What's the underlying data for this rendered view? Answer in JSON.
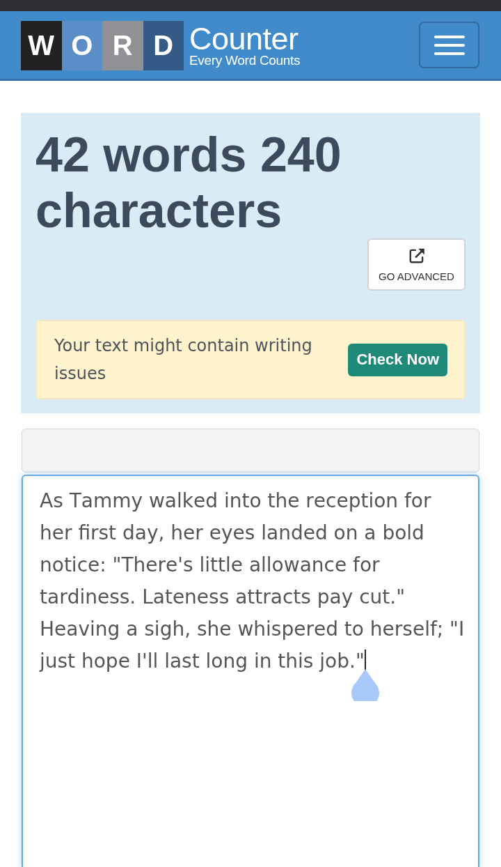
{
  "header": {
    "logo": {
      "tiles": [
        {
          "letter": "W",
          "color": "#222222"
        },
        {
          "letter": "O",
          "color": "#5b8ec7"
        },
        {
          "letter": "R",
          "color": "#8f9194"
        },
        {
          "letter": "D",
          "color": "#365a88"
        }
      ],
      "title": "Counter",
      "tagline": "Every Word Counts"
    }
  },
  "summary": {
    "heading": "42 words 240 characters",
    "advanced_button": "GO ADVANCED",
    "alert": {
      "message": "Your text might contain writing issues",
      "button": "Check Now"
    }
  },
  "editor": {
    "value": "As Tammy walked into the reception for her first day, her eyes landed on a bold notice: \"There's little allowance for tardiness. Lateness attracts pay cut.\" Heaving a sigh, she whispered to herself; \"I just hope I'll last long in this job.\""
  }
}
